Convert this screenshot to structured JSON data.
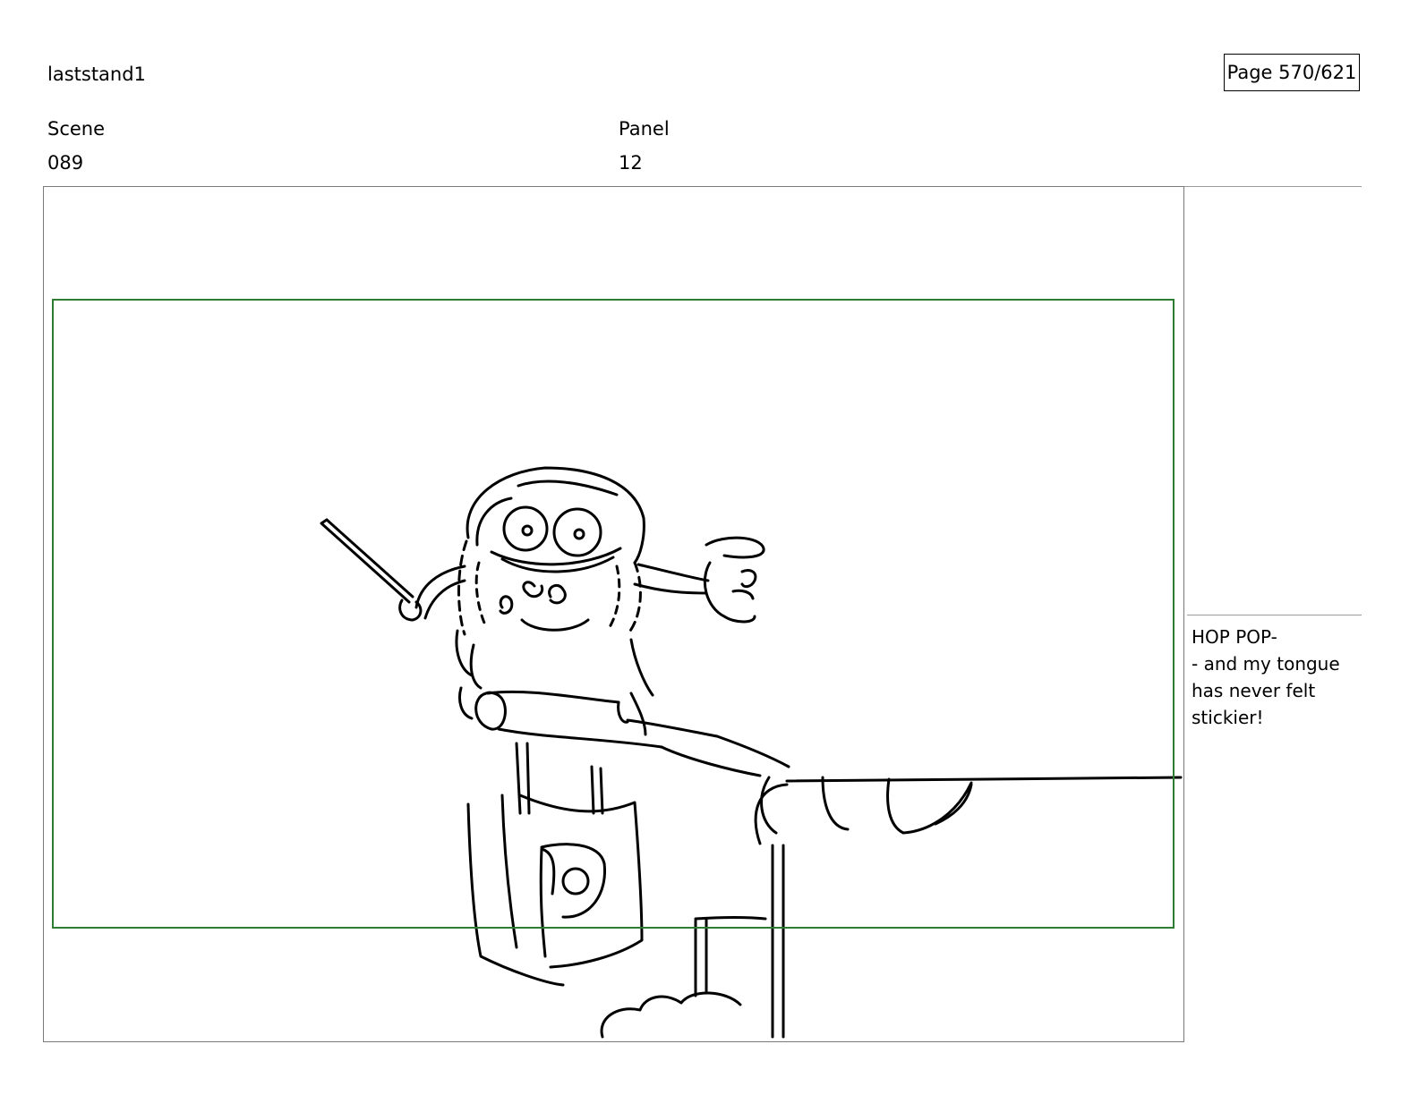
{
  "header": {
    "project_title": "laststand1",
    "page_indicator": "Page 570/621"
  },
  "fields": {
    "scene_label": "Scene",
    "scene_value": "089",
    "panel_label": "Panel",
    "panel_value": "12"
  },
  "notes": {
    "dialogue_lines": [
      "HOP POP-",
      "- and my tongue",
      "has never felt",
      "stickier!"
    ]
  },
  "colors": {
    "safe_area_border": "#2e7d32",
    "frame_border": "#7a7a7a",
    "ink": "#000000"
  }
}
